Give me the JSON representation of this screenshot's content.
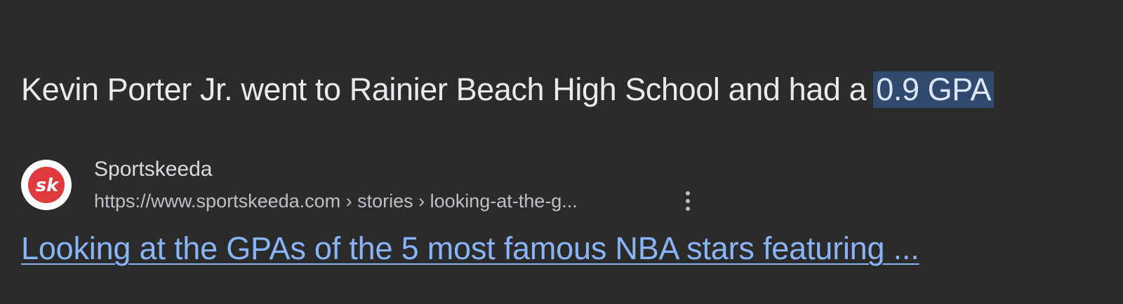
{
  "snippet": {
    "text_before": "Kevin Porter Jr. went to Rainier Beach High School and had a",
    "highlighted": "0.9 GPA"
  },
  "source": {
    "favicon": {
      "icon": "sportskeeda-logo-icon",
      "text": "sk",
      "color": "#e03a3e"
    },
    "name": "Sportskeeda",
    "url": "https://www.sportskeeda.com › stories › looking-at-the-g...",
    "more_icon": "more-vert-icon"
  },
  "result": {
    "title": "Looking at the GPAs of the 5 most famous NBA stars featuring ..."
  },
  "colors": {
    "background": "#2b2b2b",
    "text": "#e8eaed",
    "highlight_bg": "#304a6e",
    "link": "#8ab4f8",
    "url_text": "#bdc1c6"
  }
}
